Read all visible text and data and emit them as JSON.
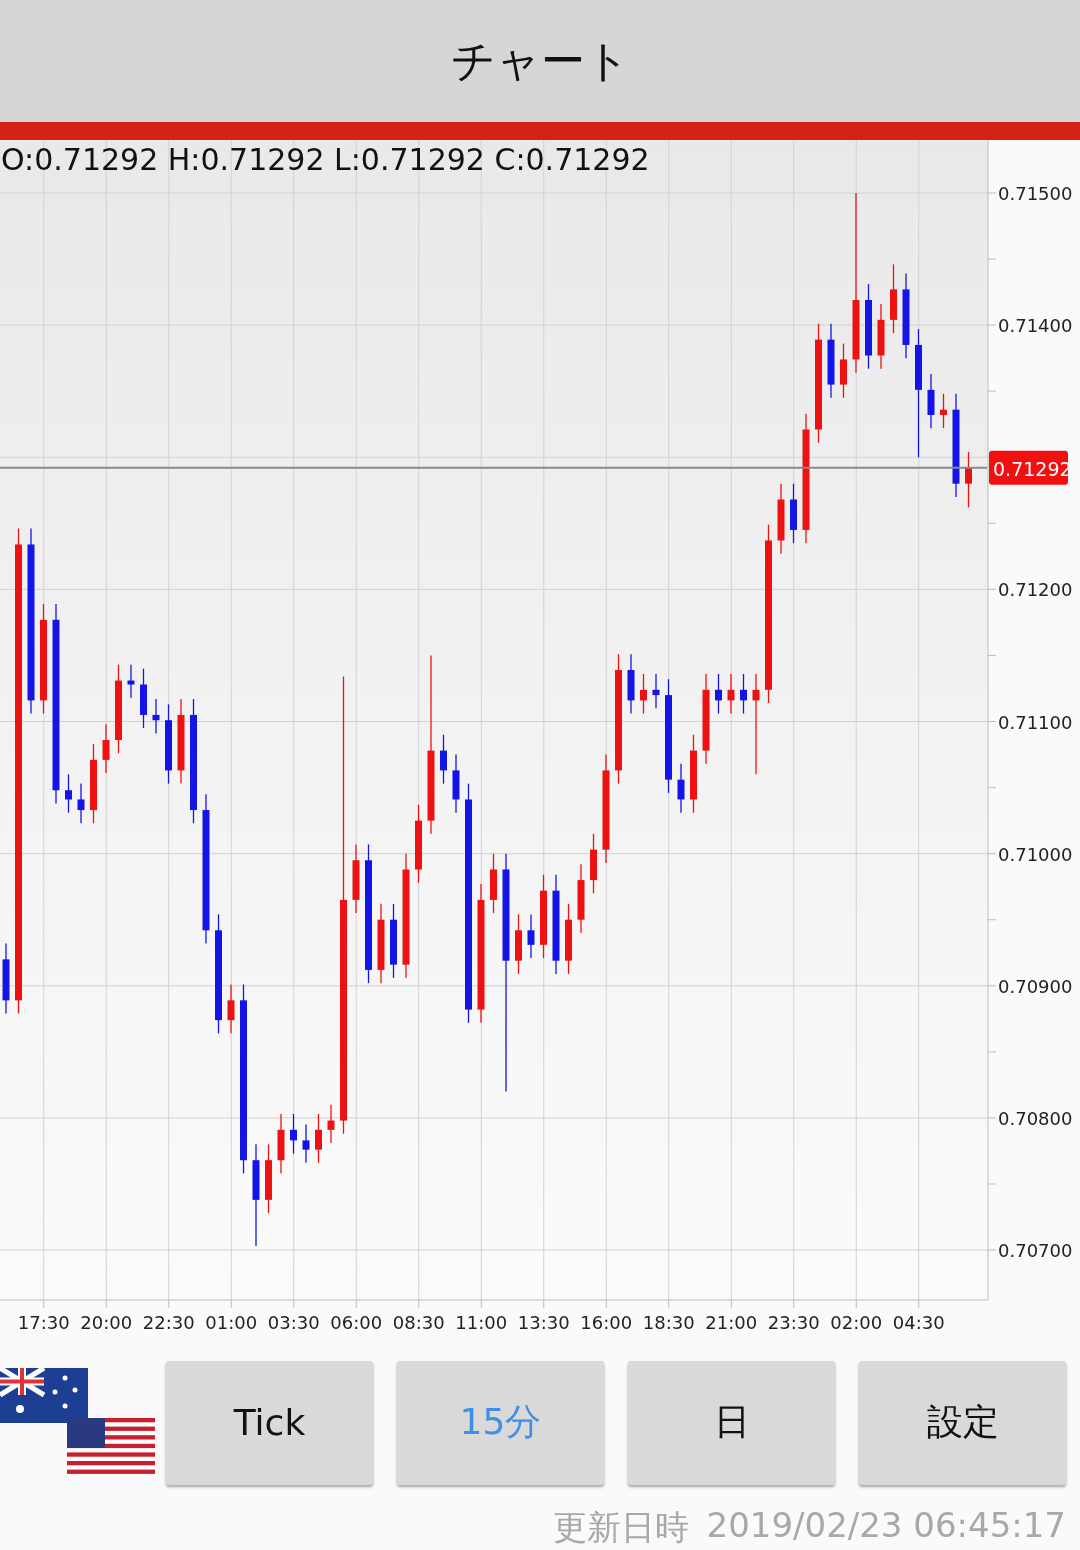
{
  "header": {
    "title": "チャート"
  },
  "chart": {
    "ohlc": "O:0.71292 H:0.71292 L:0.71292 C:0.71292",
    "chart_data": {
      "type": "candlestick",
      "grid": true,
      "ylim": [
        0.706622,
        0.715401
      ],
      "yticks": [
        {
          "value": 0.707,
          "label": "0.70700"
        },
        {
          "value": 0.708,
          "label": "0.70800"
        },
        {
          "value": 0.709,
          "label": "0.70900"
        },
        {
          "value": 0.71,
          "label": "0.71000"
        },
        {
          "value": 0.711,
          "label": "0.71100"
        },
        {
          "value": 0.712,
          "label": "0.71200"
        },
        {
          "value": 0.714,
          "label": "0.71400"
        },
        {
          "value": 0.715,
          "label": "0.71500"
        }
      ],
      "categories": [
        null,
        null,
        null,
        "17:30",
        null,
        null,
        null,
        null,
        "20:00",
        null,
        null,
        null,
        null,
        "22:30",
        null,
        null,
        null,
        null,
        "01:00",
        null,
        null,
        null,
        null,
        "03:30",
        null,
        null,
        null,
        null,
        "06:00",
        null,
        null,
        null,
        null,
        "08:30",
        null,
        null,
        null,
        null,
        "11:00",
        null,
        null,
        null,
        null,
        "13:30",
        null,
        null,
        null,
        null,
        "16:00",
        null,
        null,
        null,
        null,
        "18:30",
        null,
        null,
        null,
        null,
        "21:00",
        null,
        null,
        null,
        null,
        "23:30",
        null,
        null,
        null,
        null,
        "02:00",
        null,
        null,
        null,
        null,
        "04:30",
        null,
        null,
        null,
        null
      ],
      "ref_lines": [
        {
          "axis": "y",
          "value": 0.71292,
          "label": "0.71292",
          "color": "#8a8a8a"
        }
      ],
      "ohlc": [
        [
          0.7092,
          0.70932,
          0.70879,
          0.70889
        ],
        [
          0.70889,
          0.71246,
          0.70879,
          0.71234
        ],
        [
          0.71234,
          0.71246,
          0.71106,
          0.71116
        ],
        [
          0.71116,
          0.71189,
          0.71106,
          0.71177
        ],
        [
          0.71177,
          0.71189,
          0.71038,
          0.71048
        ],
        [
          0.71048,
          0.7106,
          0.71031,
          0.71041
        ],
        [
          0.71041,
          0.71053,
          0.71023,
          0.71033
        ],
        [
          0.71033,
          0.71083,
          0.71023,
          0.71071
        ],
        [
          0.71071,
          0.71098,
          0.71061,
          0.71086
        ],
        [
          0.71086,
          0.71143,
          0.71076,
          0.71131
        ],
        [
          0.71131,
          0.71143,
          0.71118,
          0.71128
        ],
        [
          0.71128,
          0.7114,
          0.71095,
          0.71105
        ],
        [
          0.71105,
          0.71117,
          0.71091,
          0.71101
        ],
        [
          0.71101,
          0.71113,
          0.71053,
          0.71063
        ],
        [
          0.71063,
          0.71117,
          0.71053,
          0.71105
        ],
        [
          0.71105,
          0.71117,
          0.71023,
          0.71033
        ],
        [
          0.71033,
          0.71045,
          0.70932,
          0.70942
        ],
        [
          0.70942,
          0.70954,
          0.70864,
          0.70874
        ],
        [
          0.70874,
          0.70901,
          0.70864,
          0.70889
        ],
        [
          0.70889,
          0.70901,
          0.70758,
          0.70768
        ],
        [
          0.70768,
          0.7078,
          0.70703,
          0.70738
        ],
        [
          0.70738,
          0.7078,
          0.70728,
          0.70768
        ],
        [
          0.70768,
          0.70803,
          0.70758,
          0.70791
        ],
        [
          0.70791,
          0.70803,
          0.70773,
          0.70783
        ],
        [
          0.70783,
          0.70795,
          0.70766,
          0.70776
        ],
        [
          0.70776,
          0.70803,
          0.70766,
          0.70791
        ],
        [
          0.70791,
          0.7081,
          0.70781,
          0.70798
        ],
        [
          0.70798,
          0.71134,
          0.70788,
          0.70965
        ],
        [
          0.70965,
          0.71007,
          0.70955,
          0.70995
        ],
        [
          0.70995,
          0.71007,
          0.70902,
          0.70912
        ],
        [
          0.70912,
          0.70962,
          0.70902,
          0.7095
        ],
        [
          0.7095,
          0.70962,
          0.70906,
          0.70916
        ],
        [
          0.70916,
          0.71,
          0.70906,
          0.70988
        ],
        [
          0.70988,
          0.71037,
          0.70978,
          0.71025
        ],
        [
          0.71025,
          0.7115,
          0.71015,
          0.71078
        ],
        [
          0.71078,
          0.7109,
          0.71053,
          0.71063
        ],
        [
          0.71063,
          0.71075,
          0.71031,
          0.71041
        ],
        [
          0.71041,
          0.71053,
          0.70872,
          0.70882
        ],
        [
          0.70882,
          0.70977,
          0.70872,
          0.70965
        ],
        [
          0.70965,
          0.71,
          0.70955,
          0.70988
        ],
        [
          0.70988,
          0.71,
          0.7082,
          0.70919
        ],
        [
          0.70919,
          0.70954,
          0.70909,
          0.70942
        ],
        [
          0.70942,
          0.70954,
          0.70921,
          0.70931
        ],
        [
          0.70931,
          0.70984,
          0.70921,
          0.70972
        ],
        [
          0.70972,
          0.70984,
          0.70909,
          0.70919
        ],
        [
          0.70919,
          0.70962,
          0.70909,
          0.7095
        ],
        [
          0.7095,
          0.70992,
          0.7094,
          0.7098
        ],
        [
          0.7098,
          0.71015,
          0.7097,
          0.71003
        ],
        [
          0.71003,
          0.71075,
          0.70993,
          0.71063
        ],
        [
          0.71063,
          0.71151,
          0.71053,
          0.71139
        ],
        [
          0.71139,
          0.71151,
          0.71106,
          0.71116
        ],
        [
          0.71116,
          0.71136,
          0.71106,
          0.71124
        ],
        [
          0.71124,
          0.71136,
          0.7111,
          0.7112
        ],
        [
          0.7112,
          0.71132,
          0.71046,
          0.71056
        ],
        [
          0.71056,
          0.71068,
          0.71031,
          0.71041
        ],
        [
          0.71041,
          0.7109,
          0.71031,
          0.71078
        ],
        [
          0.71078,
          0.71136,
          0.71068,
          0.71124
        ],
        [
          0.71124,
          0.71136,
          0.71106,
          0.71116
        ],
        [
          0.71116,
          0.71136,
          0.71106,
          0.71124
        ],
        [
          0.71124,
          0.71136,
          0.71106,
          0.71116
        ],
        [
          0.71116,
          0.71136,
          0.7106,
          0.71124
        ],
        [
          0.71124,
          0.71249,
          0.71114,
          0.71237
        ],
        [
          0.71237,
          0.7128,
          0.71227,
          0.71268
        ],
        [
          0.71268,
          0.7128,
          0.71235,
          0.71245
        ],
        [
          0.71245,
          0.71333,
          0.71235,
          0.71321
        ],
        [
          0.71321,
          0.71401,
          0.71311,
          0.71389
        ],
        [
          0.71389,
          0.71401,
          0.71345,
          0.71355
        ],
        [
          0.71355,
          0.71386,
          0.71345,
          0.71374
        ],
        [
          0.71374,
          0.715,
          0.71364,
          0.71419
        ],
        [
          0.71419,
          0.71431,
          0.71367,
          0.71377
        ],
        [
          0.71377,
          0.71416,
          0.71367,
          0.71404
        ],
        [
          0.71404,
          0.71446,
          0.71394,
          0.71427
        ],
        [
          0.71427,
          0.71439,
          0.71375,
          0.71385
        ],
        [
          0.71385,
          0.71397,
          0.713,
          0.71351
        ],
        [
          0.71351,
          0.71363,
          0.71322,
          0.71332
        ],
        [
          0.71332,
          0.71348,
          0.71322,
          0.71336
        ],
        [
          0.71336,
          0.71348,
          0.7127,
          0.7128
        ],
        [
          0.7128,
          0.71304,
          0.71262,
          0.71292
        ]
      ]
    }
  },
  "buttons": [
    {
      "label": "Tick",
      "selected": false
    },
    {
      "label": "15分",
      "selected": true
    },
    {
      "label": "日",
      "selected": false
    },
    {
      "label": "設定",
      "selected": false
    }
  ],
  "footer": {
    "label": "更新日時",
    "timestamp": "2019/02/23 06:45:17"
  }
}
